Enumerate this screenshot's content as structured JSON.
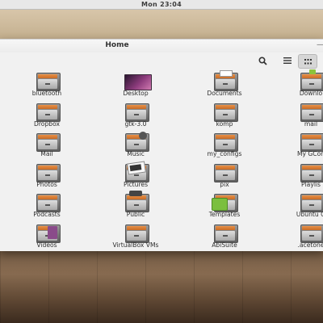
{
  "panel": {
    "clock": "Mon 23:04"
  },
  "window": {
    "title": "Home"
  },
  "toolbar": {
    "search_icon": "search-icon",
    "list_view_icon": "list-view-icon",
    "grid_view_icon": "grid-view-icon"
  },
  "items": [
    {
      "label": "bluetooth",
      "icon": "folder"
    },
    {
      "label": "Desktop",
      "icon": "desktop"
    },
    {
      "label": "Documents",
      "icon": "documents"
    },
    {
      "label": "Downlo",
      "icon": "downloads"
    },
    {
      "label": "Dropbox",
      "icon": "folder"
    },
    {
      "label": "gtk-3.0",
      "icon": "folder"
    },
    {
      "label": "komp",
      "icon": "folder"
    },
    {
      "label": "mail",
      "icon": "folder"
    },
    {
      "label": "Mail",
      "icon": "folder"
    },
    {
      "label": "Music",
      "icon": "music"
    },
    {
      "label": "my_configs",
      "icon": "folder"
    },
    {
      "label": "My GCon",
      "icon": "folder"
    },
    {
      "label": "Photos",
      "icon": "folder"
    },
    {
      "label": "Pictures",
      "icon": "pictures"
    },
    {
      "label": "pix",
      "icon": "folder"
    },
    {
      "label": "Playlis",
      "icon": "folder"
    },
    {
      "label": "Podcasts",
      "icon": "folder"
    },
    {
      "label": "Public",
      "icon": "public"
    },
    {
      "label": "Templates",
      "icon": "templates"
    },
    {
      "label": "Ubuntu O",
      "icon": "folder"
    },
    {
      "label": "Videos",
      "icon": "videos"
    },
    {
      "label": "VirtualBox VMs",
      "icon": "folder"
    },
    {
      "label": "AbiSuite",
      "icon": "folder"
    },
    {
      "label": ".acetone",
      "icon": "folder"
    }
  ]
}
